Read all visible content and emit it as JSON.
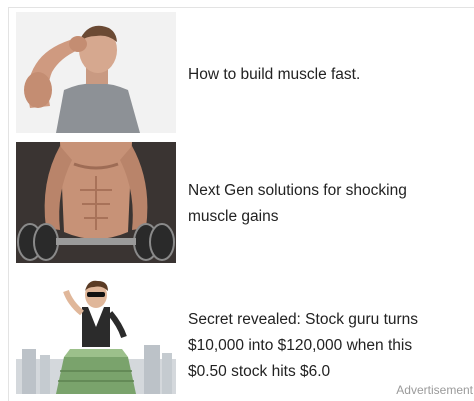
{
  "ads": [
    {
      "headline_lines": [
        "How to build muscle fast."
      ],
      "image": "man-flexing-bicep-photo"
    },
    {
      "headline_lines": [
        "Next Gen solutions for shocking",
        "muscle gains"
      ],
      "image": "shirtless-man-with-dumbbells-photo"
    },
    {
      "headline_lines": [
        "Secret revealed: Stock guru turns",
        "$10,000 into $120,000 when this",
        "$0.50 stock hits $6.0"
      ],
      "image": "man-on-cash-stack-photo"
    }
  ],
  "attribution": "Advertisement"
}
